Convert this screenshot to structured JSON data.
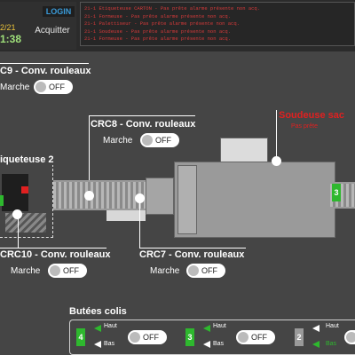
{
  "header": {
    "login": "LOGIN",
    "date": "2/21",
    "time": "1:38",
    "ack": "Acquitter",
    "alarms": [
      "21-1 Etiqueteuse CARTON - Pas prête alarme présente non acq.",
      "21-1 Formeuse - Pas prête alarme présente non acq.",
      "21-1 Palettiseur - Pas prête alarme présente non acq.",
      "21-1 Soudeuse - Pas prête alarme présente non acq.",
      "21-1 Formeuse - Pas prête alarme présente non acq."
    ]
  },
  "conveyors": {
    "crc9": {
      "title": "C9 - Conv. rouleaux",
      "marche": "Marche",
      "state": "OFF"
    },
    "crc8": {
      "title": "CRC8 - Conv. rouleaux",
      "marche": "Marche",
      "state": "OFF"
    },
    "crc10": {
      "title": "CRC10 - Conv. rouleaux",
      "marche": "Marche",
      "state": "OFF"
    },
    "crc7": {
      "title": "CRC7 - Conv. rouleaux",
      "marche": "Marche",
      "state": "OFF"
    }
  },
  "soudeuse": {
    "title": "Soudeuse sac",
    "status": "Pas prête"
  },
  "etiqueteuse": {
    "title": "iqueteuse 2"
  },
  "butees": {
    "title": "Butées colis",
    "items": [
      {
        "num": "4",
        "haut": "Haut",
        "bas": "Bas",
        "state": "OFF",
        "color": "#2eb82e"
      },
      {
        "num": "3",
        "haut": "Haut",
        "bas": "Bas",
        "state": "OFF",
        "color": "#2eb82e"
      },
      {
        "num": "2",
        "haut": "Haut",
        "bas": "Bas",
        "state": "OFF",
        "color": "#9a9a9a"
      }
    ]
  },
  "side_badge": "3"
}
